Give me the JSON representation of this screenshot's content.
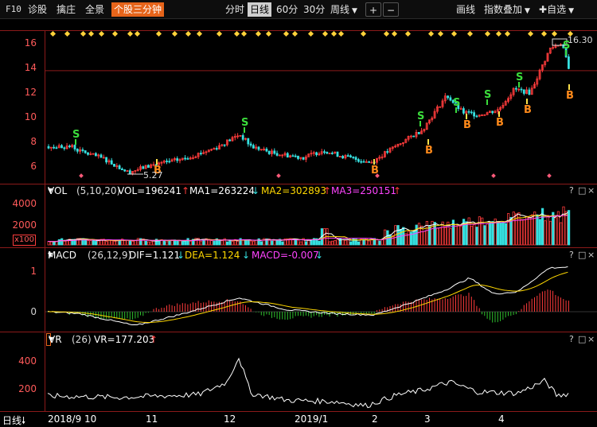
{
  "toolbar": {
    "left": [
      "F10",
      "诊股",
      "擒庄",
      "全景"
    ],
    "active_tab": "个股三分钟",
    "periods": [
      "分时",
      "日线",
      "60分",
      "30分",
      "周线"
    ],
    "active_period": "日线",
    "zoom_in": "+",
    "zoom_out": "−",
    "draw": "画线",
    "index_overlay": "指数叠加",
    "add_watchlist": "自选"
  },
  "price_panel": {
    "y_ticks": [
      "16",
      "14",
      "12",
      "10",
      "8",
      "6"
    ],
    "high_label": "16.30",
    "low_label": "5.27",
    "signals": {
      "buy": "B",
      "sell": "S"
    }
  },
  "vol_panel": {
    "name": "VOL",
    "params": "(5,10,20)",
    "vol": "VOL=196241",
    "ma1": "MA1=263224",
    "ma2": "MA2=302893",
    "ma3": "MA3=250151",
    "y_ticks": [
      "4000",
      "2000"
    ],
    "unit": "x100"
  },
  "macd_panel": {
    "name": "MACD",
    "params": "(26,12,9)",
    "dif": "DIF=1.121",
    "dea": "DEA=1.124",
    "macd": "MACD=-0.007",
    "y_ticks": [
      "1",
      "0"
    ]
  },
  "vr_panel": {
    "name": "VR",
    "params": "(26)",
    "vr": "VR=177.203",
    "y_ticks": [
      "400",
      "200"
    ]
  },
  "time_axis": {
    "period_label": "日线",
    "labels": [
      "2018/9",
      "10",
      "11",
      "12",
      "2019/1",
      "2",
      "3",
      "4"
    ]
  },
  "panel_controls": [
    "?",
    "□",
    "×"
  ],
  "colors": {
    "up": "#ff3b3b",
    "down": "#36e0e0",
    "grid": "#8b1a1a",
    "accent": "#e6641a",
    "diamond": "#ffd23a",
    "ma1": "#ffffff",
    "ma2": "#ffd800",
    "ma3": "#ff44ff"
  }
}
